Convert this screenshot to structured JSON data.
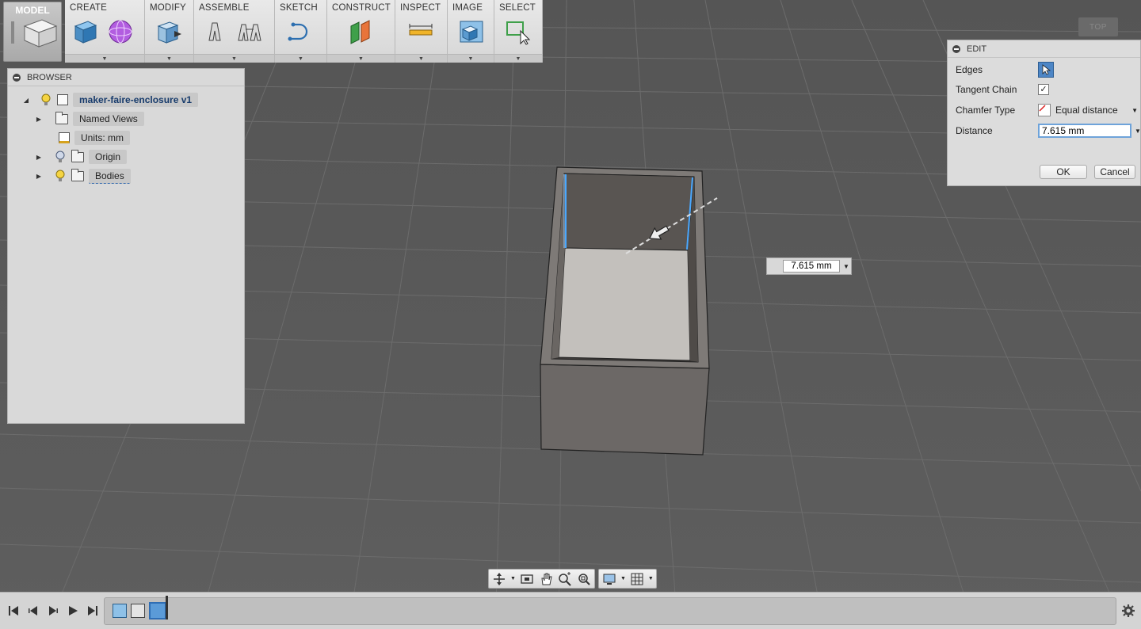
{
  "toolbar": {
    "workspace": "MODEL",
    "groups": [
      {
        "label": "CREATE"
      },
      {
        "label": "MODIFY"
      },
      {
        "label": "ASSEMBLE"
      },
      {
        "label": "SKETCH"
      },
      {
        "label": "CONSTRUCT"
      },
      {
        "label": "INSPECT"
      },
      {
        "label": "IMAGE"
      },
      {
        "label": "SELECT"
      }
    ]
  },
  "browser": {
    "title": "BROWSER",
    "root": "maker-faire-enclosure v1",
    "items": [
      "Named Views",
      "Units: mm",
      "Origin",
      "Bodies"
    ]
  },
  "edit_panel": {
    "title": "EDIT",
    "edges_label": "Edges",
    "tangent_chain_label": "Tangent Chain",
    "tangent_chain_checked": true,
    "chamfer_type_label": "Chamfer Type",
    "chamfer_type_value": "Equal distance",
    "distance_label": "Distance",
    "distance_value": "7.615 mm",
    "ok_label": "OK",
    "cancel_label": "Cancel"
  },
  "callout": {
    "value": "7.615 mm"
  },
  "viewcube": {
    "face": "TOP"
  },
  "icons": {
    "create": [
      "box-icon",
      "sphere-icon"
    ],
    "modify": [
      "press-pull-icon"
    ],
    "assemble": [
      "joint-icon",
      "as-built-joint-icon"
    ],
    "sketch": [
      "line-arc-icon"
    ],
    "construct": [
      "plane-icon"
    ],
    "inspect": [
      "measure-icon"
    ],
    "image": [
      "render-icon"
    ],
    "select": [
      "select-icon"
    ]
  }
}
